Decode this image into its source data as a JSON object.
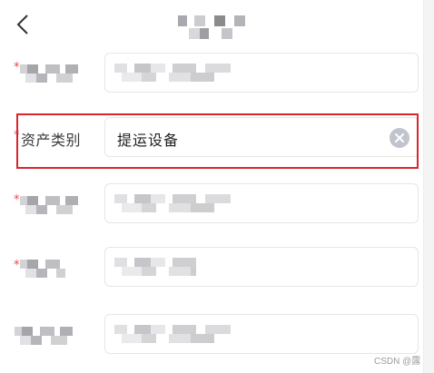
{
  "header": {
    "back_icon": "chevron-left-icon"
  },
  "form": {
    "required_mark": "*",
    "asset_category": {
      "label": "资产类别",
      "value": "提运设备",
      "clear_icon": "clear-circle-icon"
    }
  },
  "watermark": {
    "text": "CSDN @露"
  },
  "colors": {
    "required": "#e54a4a",
    "highlight_border": "#d9262e",
    "clear_button": "#c0c4cc",
    "field_border": "#e6e6e6"
  }
}
